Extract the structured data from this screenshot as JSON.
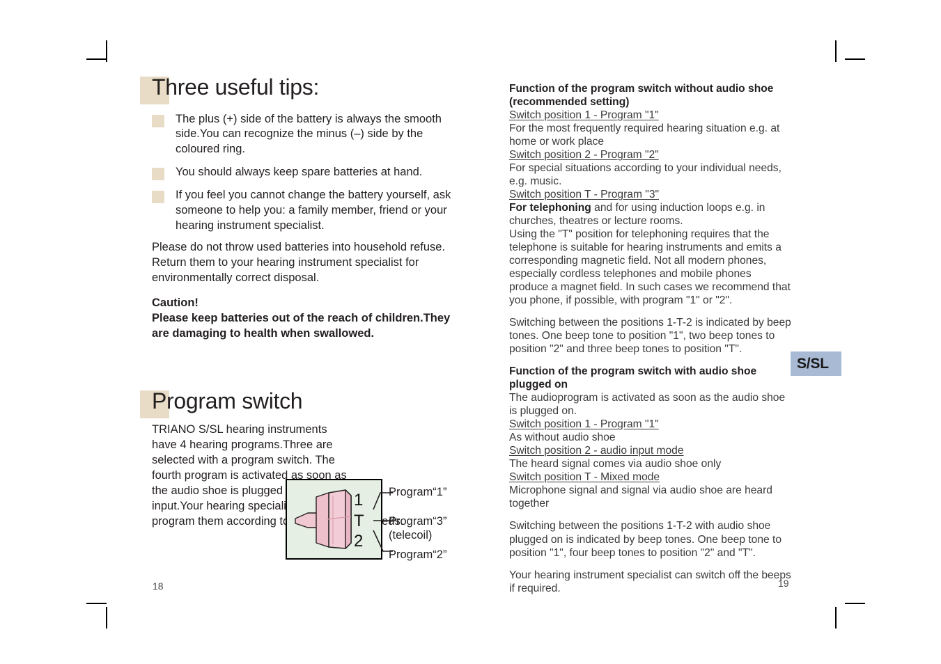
{
  "page": {
    "folio_left": "18",
    "folio_right": "19",
    "badge": "S/SL",
    "colors": {
      "heading_swatch": "#e8dcc6",
      "bullet_square": "#e8dcc6",
      "diagram_background": "#e6efe4",
      "diagram_border": "#000000",
      "switch_knob": "#f0c8d2",
      "badge_background": "#a8bad4",
      "body_text": "#231f20"
    }
  },
  "left": {
    "tips_heading": "Three useful tips:",
    "tips": [
      "The plus (+) side of the battery is always the smooth side.You can recognize the minus (–) side by the coloured ring.",
      "You should always keep spare batteries at hand.",
      "If you feel you cannot change the battery yourself, ask someone to help you: a family member, friend or your hearing instrument specialist."
    ],
    "disposal_paragraph": "Please do not throw used batteries into household refuse. Return them to your hearing instrument specialist for environmentally correct disposal.",
    "caution_title": "Caution!",
    "caution_text": "Please keep batteries out of the reach of children.They are damaging to health when swallowed.",
    "program_switch_heading": "Program switch",
    "program_switch_body": "TRIANO S/SL hearing instruments have 4 hearing programs.Three are selected with a program switch. The fourth program is activated as soon as the audio shoe is plugged to the audio input.Your hearing specialist will program them according to your individual needs.",
    "diagram": {
      "switch_positions": [
        "1",
        "T",
        "2"
      ],
      "labels": [
        {
          "id": "program-1",
          "line1": "Program“1”",
          "line2": ""
        },
        {
          "id": "program-3",
          "line1": "Program“3”",
          "line2": "(telecoil)"
        },
        {
          "id": "program-2",
          "line1": "Program“2”",
          "line2": ""
        }
      ]
    }
  },
  "right": {
    "without_shoe": {
      "heading_line1": "Function of the program switch without audio shoe",
      "heading_line2": "(recommended setting)",
      "pos1_title": "Switch position 1 - Program \"1\"",
      "pos1_text": "For the most frequently required hearing situation e.g. at home or work place",
      "pos2_title": "Switch position 2 - Program \"2\"",
      "pos2_text": "For special situations according to your individual needs, e.g. music.",
      "posT_title": "Switch position T - Program \"3\"",
      "posT_bold": "For telephoning",
      "posT_text": " and for using induction loops e.g. in churches, theatres or lecture rooms.",
      "posT_extra": "Using the \"T\" position for telephoning requires that the telephone is suitable for hearing instruments and emits a corresponding magnetic field. Not all modern phones, especially cordless telephones and mobile phones produce a magnet field. In such cases we recommend that you phone, if possible, with program \"1\" or \"2\".",
      "beeps": "Switching between the positions 1-T-2 is indicated by beep tones. One beep tone to position \"1\", two beep tones to position \"2\" and three beep tones to position \"T\"."
    },
    "with_shoe": {
      "heading_line1": "Function of the program switch with audio shoe",
      "heading_line2": "plugged on",
      "intro": "The audioprogram is activated as soon as the audio shoe is plugged on.",
      "pos1_title": "Switch position 1 - Program \"1\"",
      "pos1_text": "As without audio shoe",
      "pos2_title": "Switch position 2 - audio input mode",
      "pos2_text": "The heard signal comes via audio shoe only",
      "posT_title": "Switch position T - Mixed mode",
      "posT_text": "Microphone signal and signal via audio shoe are heard together",
      "beeps": "Switching between the positions 1-T-2 with audio shoe plugged on is indicated by beep tones. One beep tone to position \"1\", four beep tones to position \"2\" and \"T\".",
      "closing": "Your hearing instrument specialist can switch off the beeps if required."
    }
  }
}
